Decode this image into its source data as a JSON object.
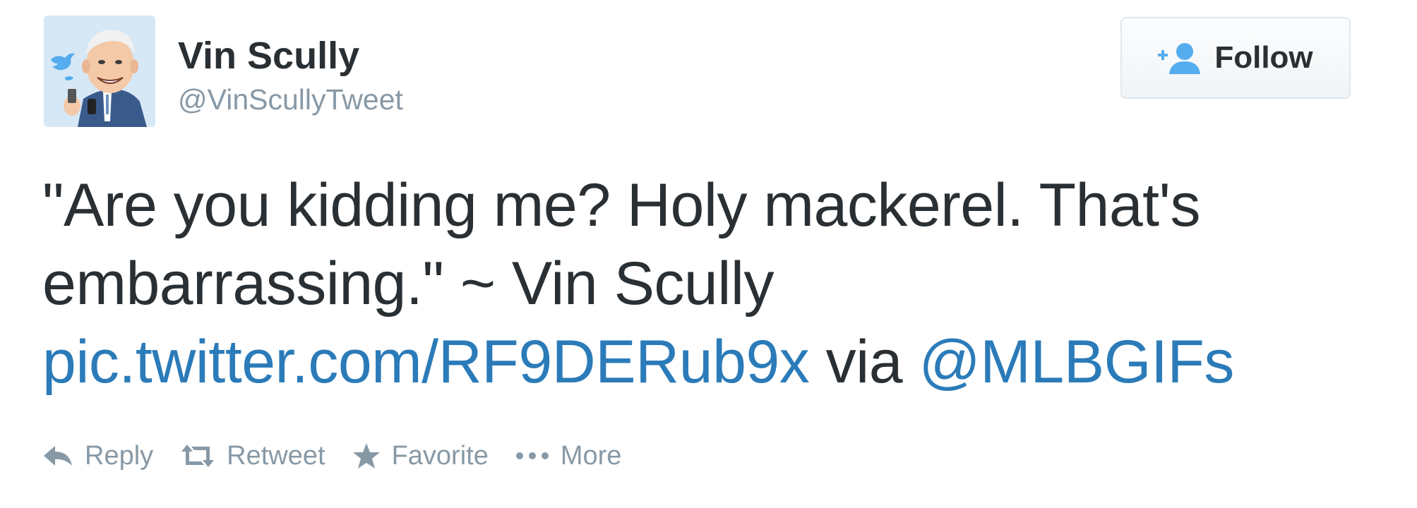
{
  "user": {
    "display_name": "Vin Scully",
    "screen_name": "@VinScullyTweet",
    "avatar_icon": "caricature-avatar-icon"
  },
  "follow": {
    "label": "Follow",
    "icon": "add-user-icon"
  },
  "tweet": {
    "line1": "\"Are you kidding me? Holy mackerel. That's",
    "line2": "embarrassing.\" ~ Vin Scully",
    "link": "pic.twitter.com/RF9DERub9x",
    "via": " via ",
    "mention": "@MLBGIFs"
  },
  "actions": {
    "reply": "Reply",
    "retweet": "Retweet",
    "favorite": "Favorite",
    "more": "More"
  },
  "colors": {
    "link": "#2b7bb9",
    "text": "#292f33",
    "muted": "#8899a6"
  }
}
